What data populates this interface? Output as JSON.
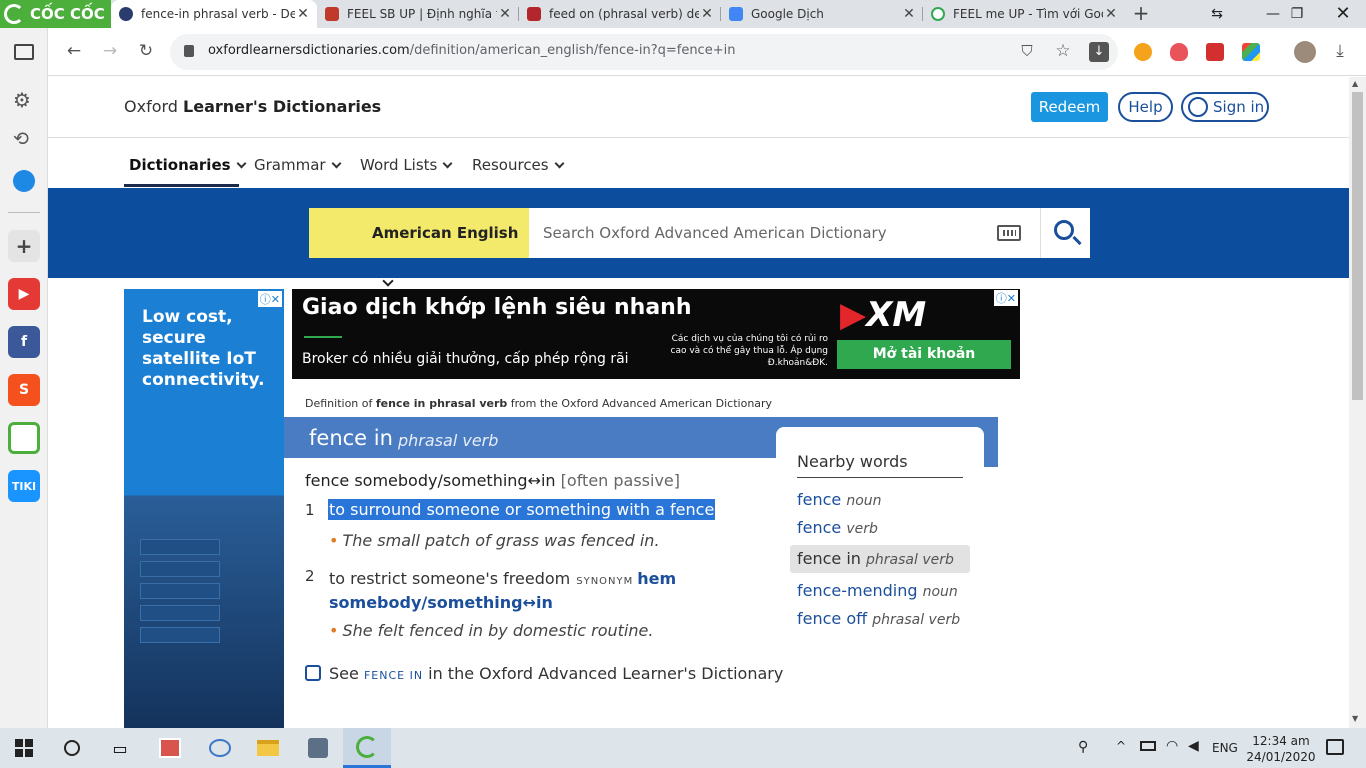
{
  "browser": {
    "name": "CỐC CỐC",
    "tabs": [
      {
        "title": "fence-in phrasal verb - Defi",
        "active": true,
        "favicon_color": "#2a3b6e"
      },
      {
        "title": "FEEL SB UP | Định nghĩa tro",
        "active": false,
        "favicon_color": "#c0392b"
      },
      {
        "title": "feed on (phrasal verb) defin",
        "active": false,
        "favicon_color": "#b3262b"
      },
      {
        "title": "Google Dịch",
        "active": false,
        "favicon_color": "#4285f4"
      },
      {
        "title": "FEEL me UP - Tìm với Goog",
        "active": false,
        "favicon_color": "#34a853"
      }
    ],
    "url_host": "oxfordlearnersdictionaries.com",
    "url_path": "/definition/american_english/fence-in?q=fence+in"
  },
  "site": {
    "title_prefix": "Oxford ",
    "title_bold": "Learner's Dictionaries",
    "redeem_label": "Redeem",
    "help_label": "Help",
    "signin_label": "Sign in",
    "nav": [
      "Dictionaries",
      "Grammar",
      "Word Lists",
      "Resources"
    ],
    "dictionary_select": "American English",
    "search_placeholder": "Search Oxford Advanced American Dictionary"
  },
  "ads": {
    "left_text": "Low cost, secure satellite IoT connectivity.",
    "top_headline": "Giao dịch khớp lệnh siêu nhanh",
    "top_sub": "Broker có nhiều giải thưởng, cấp phép rộng rãi",
    "top_disclaimer": "Các dịch vụ của chúng tôi có rủi ro cao và có thể gây thua lỗ. Áp dụng Đ.khoản&ĐK.",
    "top_brand": "XM",
    "top_cta": "Mở tài khoản"
  },
  "entry": {
    "source_prefix": "Definition of ",
    "source_word": "fence in phrasal verb",
    "source_suffix": " from the Oxford Advanced American Dictionary",
    "headword": "fence in",
    "pos": "phrasal verb",
    "phrase": "fence somebody/something↔in",
    "phrase_label": "[often passive]",
    "senses": [
      {
        "num": "1",
        "text": "to surround someone or something with a fence",
        "example": "The small patch of grass was fenced in."
      },
      {
        "num": "2",
        "text": "to restrict someone's freedom",
        "synonym_label": "SYNONYM",
        "synonym_line1": "hem",
        "synonym_line2": "somebody/something↔in",
        "example": "She felt fenced in by domestic routine."
      }
    ],
    "see_prefix": "See ",
    "see_term": "FENCE IN",
    "see_suffix": " in the Oxford Advanced Learner's Dictionary"
  },
  "nearby": {
    "title": "Nearby words",
    "items": [
      {
        "word": "fence",
        "pos": "noun"
      },
      {
        "word": "fence",
        "pos": "verb"
      },
      {
        "word": "fence in",
        "pos": "phrasal verb",
        "current": true
      },
      {
        "word": "fence-mending",
        "pos": "noun"
      },
      {
        "word": "fence off",
        "pos": "phrasal verb"
      }
    ]
  },
  "taskbar": {
    "language": "ENG",
    "time": "12:34 am",
    "date": "24/01/2020"
  }
}
